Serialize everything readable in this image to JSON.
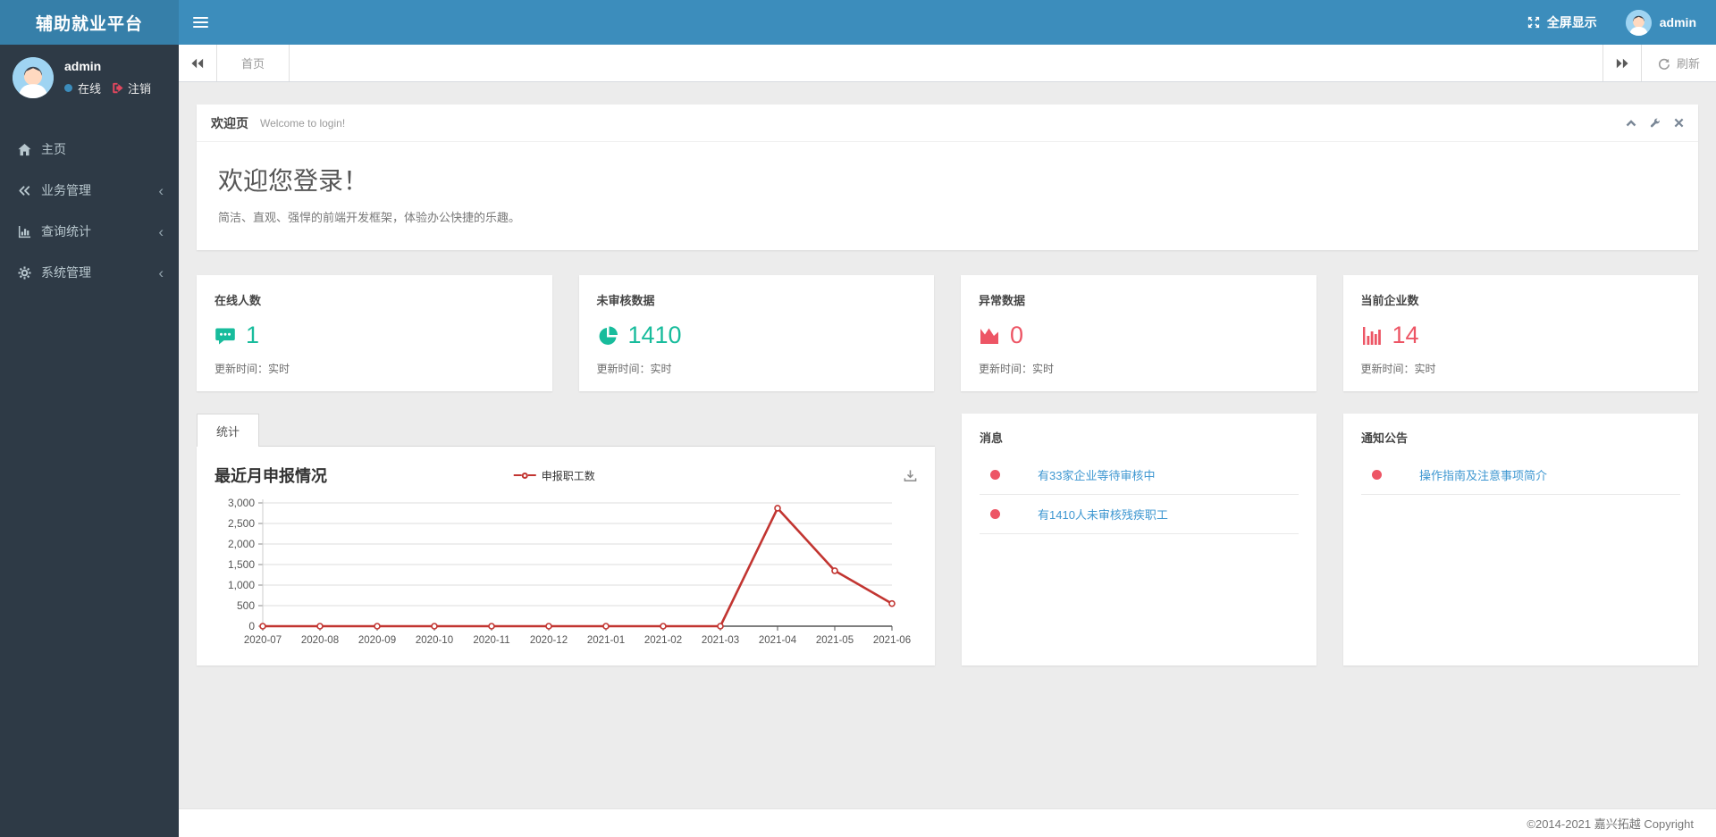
{
  "app": {
    "brand": "辅助就业平台",
    "fullscreen_label": "全屏显示",
    "username": "admin"
  },
  "sidebar": {
    "user": {
      "name": "admin",
      "status": "在线",
      "logout": "注销"
    },
    "items": [
      {
        "key": "home",
        "label": "主页",
        "icon": "home-icon",
        "expandable": false
      },
      {
        "key": "business",
        "label": "业务管理",
        "icon": "gem-icon",
        "expandable": true
      },
      {
        "key": "statistics",
        "label": "查询统计",
        "icon": "bar-chart-icon",
        "expandable": true
      },
      {
        "key": "system",
        "label": "系统管理",
        "icon": "gear-icon",
        "expandable": true
      }
    ]
  },
  "tabbar": {
    "active_tab": "首页",
    "refresh_label": "刷新"
  },
  "welcome": {
    "title": "欢迎页",
    "subtitle": "Welcome to login!",
    "heading": "欢迎您登录！",
    "description": "简洁、直观、强悍的前端开发框架，体验办公快捷的乐趣。"
  },
  "stat_cards": [
    {
      "title": "在线人数",
      "value": "1",
      "icon": "comment-icon",
      "color": "#18bc9c",
      "footer": "更新时间：实时"
    },
    {
      "title": "未审核数据",
      "value": "1410",
      "icon": "pie-chart-icon",
      "color": "#18bc9c",
      "footer": "更新时间：实时"
    },
    {
      "title": "异常数据",
      "value": "0",
      "icon": "area-chart-icon",
      "color": "#ed5565",
      "footer": "更新时间：实时"
    },
    {
      "title": "当前企业数",
      "value": "14",
      "icon": "bars-icon",
      "color": "#ed5565",
      "footer": "更新时间：实时"
    }
  ],
  "chart_panel": {
    "tab": "统计",
    "title": "最近月申报情况"
  },
  "chart_data": {
    "type": "line",
    "title": "最近月申报情况",
    "categories": [
      "2020-07",
      "2020-08",
      "2020-09",
      "2020-10",
      "2020-11",
      "2020-12",
      "2021-01",
      "2021-02",
      "2021-03",
      "2021-04",
      "2021-05",
      "2021-06"
    ],
    "series": [
      {
        "name": "申报职工数",
        "color": "#c23531",
        "values": [
          0,
          0,
          0,
          0,
          0,
          0,
          0,
          0,
          0,
          2870,
          1350,
          550
        ]
      }
    ],
    "xlabel": "",
    "ylabel": "",
    "ylim": [
      0,
      3000
    ],
    "ytick_interval": 500,
    "grid": true,
    "legend_position": "top-center"
  },
  "messages": {
    "title": "消息",
    "items": [
      {
        "text": "有33家企业等待审核中"
      },
      {
        "text": "有1410人未审核残疾职工"
      }
    ]
  },
  "notices": {
    "title": "通知公告",
    "items": [
      {
        "text": "操作指南及注意事项简介"
      }
    ]
  },
  "footer": {
    "copyright": "©2014-2021 嘉兴拓越 Copyright"
  },
  "colors": {
    "header": "#3c8dbc",
    "logo_bg": "#367fa9",
    "sidebar_bg": "#2e3a46",
    "positive": "#18bc9c",
    "negative": "#ed5565",
    "link": "#3e97d1",
    "chart_line": "#c23531"
  }
}
